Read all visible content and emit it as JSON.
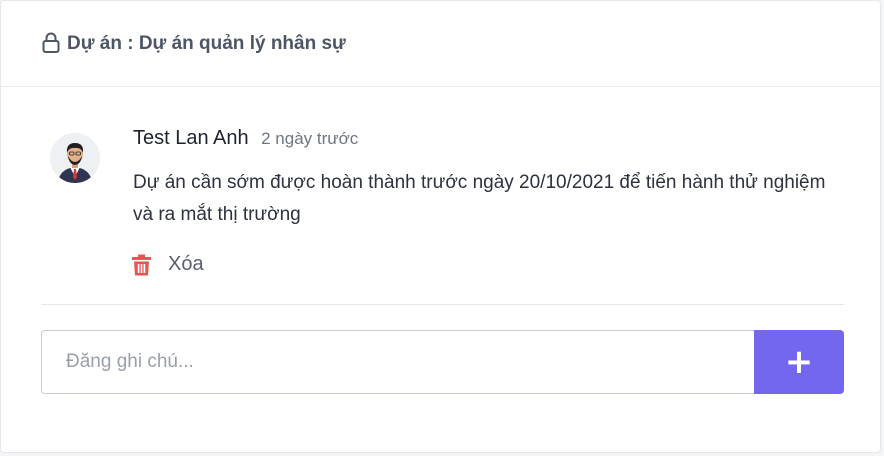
{
  "header": {
    "icon": "lock-icon",
    "title": "Dự án : Dự án quản lý nhân sự"
  },
  "comment": {
    "avatar_icon": "businessman-avatar",
    "author": "Test Lan Anh",
    "time": "2 ngày trước",
    "text": "Dự án cần sớm được hoàn thành trước ngày 20/10/2021 để tiến hành thử nghiệm và ra mắt thị trường",
    "delete_icon": "trash-icon",
    "delete_label": "Xóa"
  },
  "composer": {
    "placeholder": "Đăng ghi chú...",
    "value": "",
    "add_label": "+"
  },
  "colors": {
    "accent": "#7367f0",
    "danger": "#ea5455",
    "header_text": "#4d5566"
  }
}
